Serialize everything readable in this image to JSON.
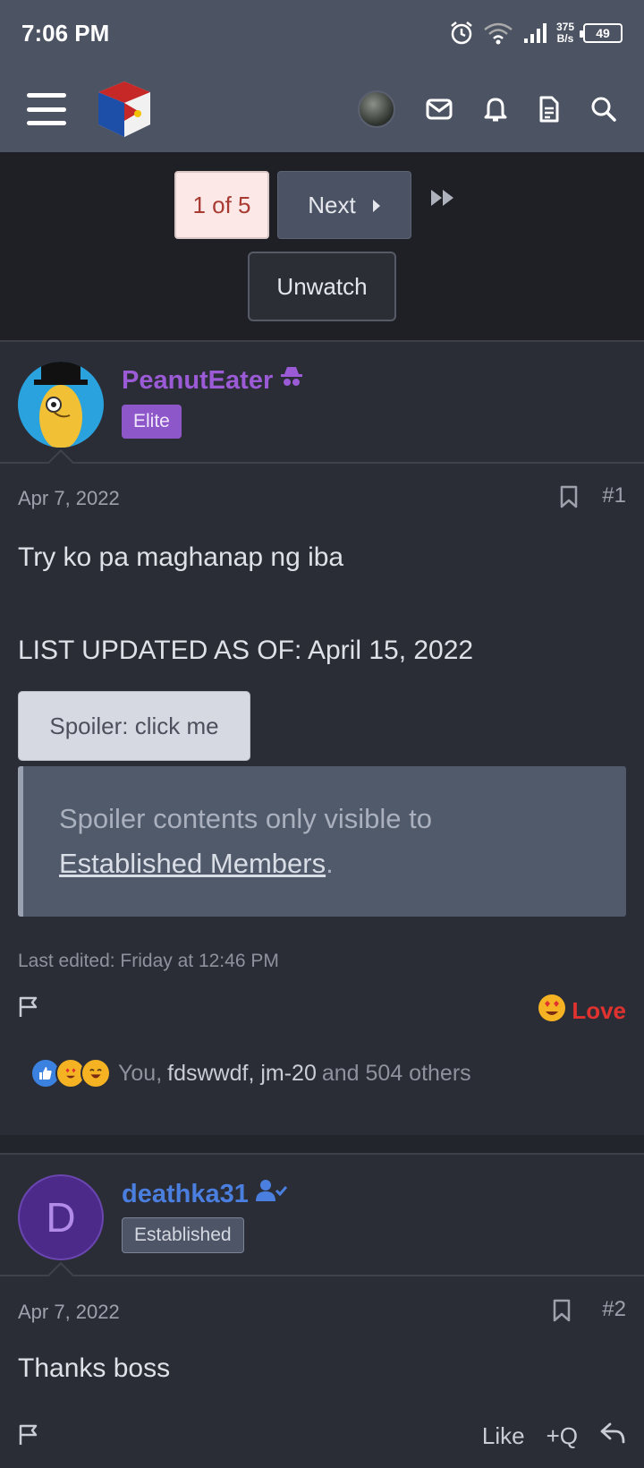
{
  "status_bar": {
    "time": "7:06 PM",
    "net_speed_value": "375",
    "net_speed_unit": "B/s",
    "battery": "49"
  },
  "nav": {
    "icons": [
      "menu-icon",
      "site-logo",
      "user-avatar",
      "inbox-icon",
      "bell-icon",
      "document-icon",
      "search-icon"
    ]
  },
  "pager": {
    "current": "1 of 5",
    "next": "Next",
    "unwatch": "Unwatch"
  },
  "posts": [
    {
      "username": "PeanutEater",
      "badge": "Elite",
      "date": "Apr 7, 2022",
      "number": "#1",
      "text_line1": "Try ko pa maghanap ng iba",
      "text_line2": "LIST UPDATED AS OF: April 15, 2022",
      "spoiler_button": "Spoiler: click me",
      "spoiler_text": "Spoiler contents only visible to",
      "spoiler_link": "Established Members",
      "spoiler_suffix": ".",
      "last_edited": "Last edited: Friday at 12:46 PM",
      "reaction_label": "Love",
      "reactions_prefix": "You,",
      "reactions_names": "fdswwdf, jm-20",
      "reactions_suffix": "and 504 others",
      "colors": {
        "username": "#9b5bd6",
        "badge_bg": "#8e57c9"
      }
    },
    {
      "username": "deathka31",
      "avatar_letter": "D",
      "badge": "Established",
      "date": "Apr 7, 2022",
      "number": "#2",
      "text_line1": "Thanks boss",
      "like_label": "Like",
      "quote_label": "+Q",
      "colors": {
        "username": "#4a7fe0",
        "avatar_bg": "#4b2a8a"
      }
    }
  ]
}
